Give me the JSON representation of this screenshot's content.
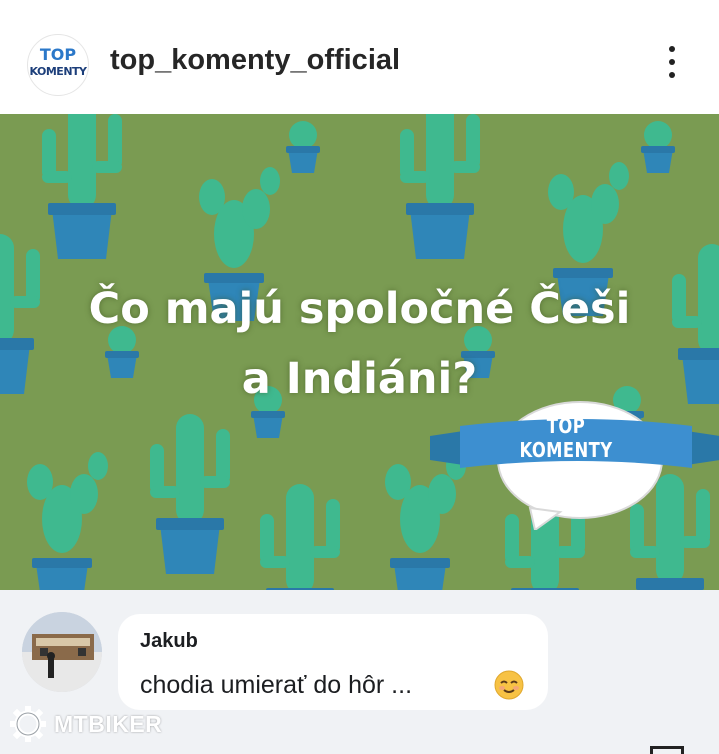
{
  "header": {
    "avatar_line1": "TOP",
    "avatar_line2": "KOMENTY",
    "username": "top_komenty_official",
    "more_icon": "more-vertical-icon"
  },
  "post": {
    "headline_line1": "Čo majú spoločné Češi",
    "headline_line2": "a Indiáni?",
    "banner_label": "TOP KOMENTY",
    "colors": {
      "background": "#7a9b52",
      "cactus": "#3fb98f",
      "pot": "#2f86b8",
      "banner": "#3d8fd0"
    }
  },
  "comment": {
    "author": "Jakub",
    "text": "chodia umierať do hôr ...",
    "emoji": "relieved-face-emoji"
  },
  "watermark": {
    "icon": "gear-logo-icon",
    "text": "MTBIKER"
  }
}
